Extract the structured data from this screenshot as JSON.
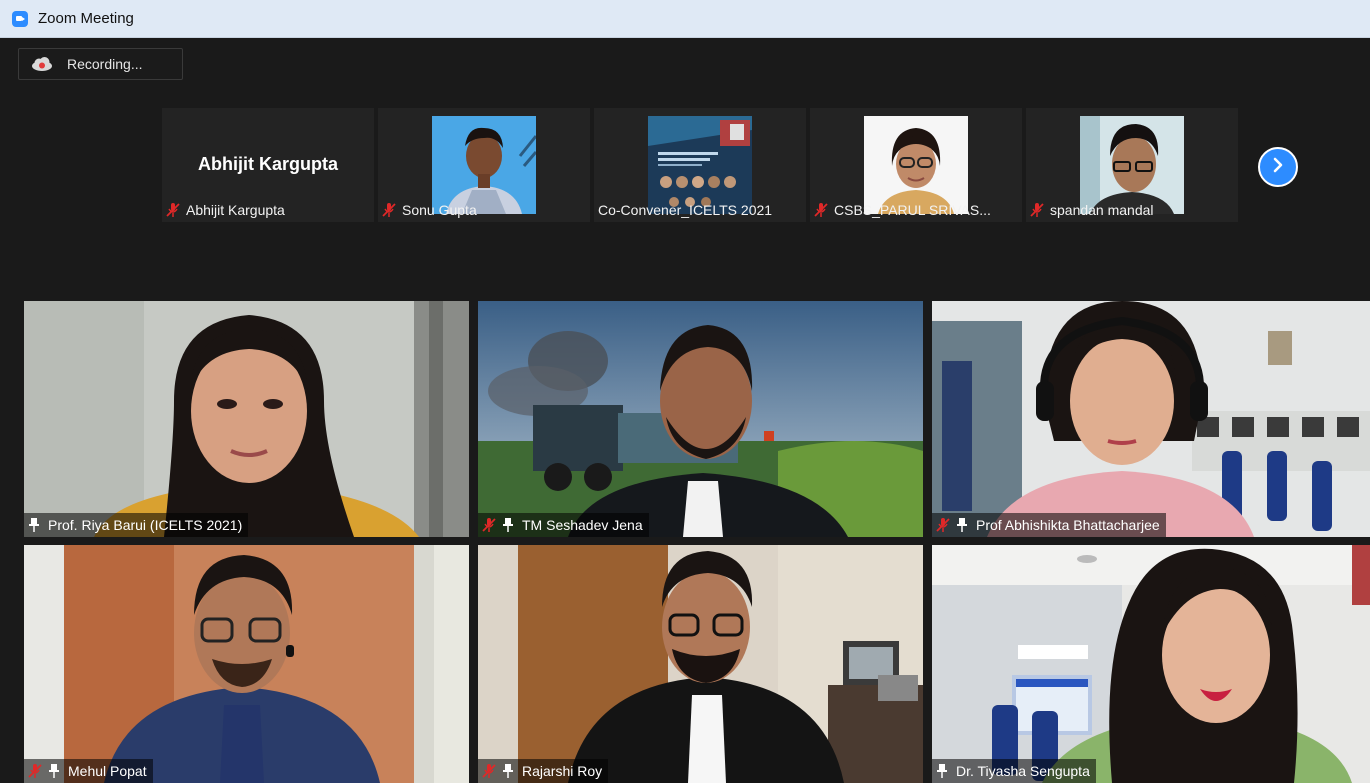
{
  "window": {
    "title": "Zoom Meeting"
  },
  "recording": {
    "label": "Recording..."
  },
  "strip": [
    {
      "name": "Abhijit Kargupta",
      "display": "Abhijit Kargupta",
      "muted": true
    },
    {
      "name": "Sonu Gupta",
      "muted": true
    },
    {
      "name": "Co-Convener_ICELTS 2021",
      "muted": false
    },
    {
      "name": "CSBS_PARUL SRIVAS...",
      "muted": true
    },
    {
      "name": "spandan mandal",
      "muted": true
    }
  ],
  "grid": [
    {
      "name": "Prof. Riya Barui (ICELTS 2021)",
      "muted": false,
      "pinned": true
    },
    {
      "name": "TM Seshadev Jena",
      "muted": true,
      "pinned": true
    },
    {
      "name": "Prof Abhishikta Bhattacharjee",
      "muted": true,
      "pinned": true
    },
    {
      "name": "Mehul Popat",
      "muted": true,
      "pinned": true
    },
    {
      "name": "Rajarshi Roy",
      "muted": true,
      "pinned": true
    },
    {
      "name": "Dr. Tiyasha Sengupta",
      "muted": false,
      "pinned": true
    }
  ],
  "colors": {
    "accent": "#2d8cff",
    "mute": "#e02828",
    "background": "#1a1a1a"
  },
  "icons": {
    "next": "chevron-right-icon",
    "record": "cloud-record-icon"
  }
}
